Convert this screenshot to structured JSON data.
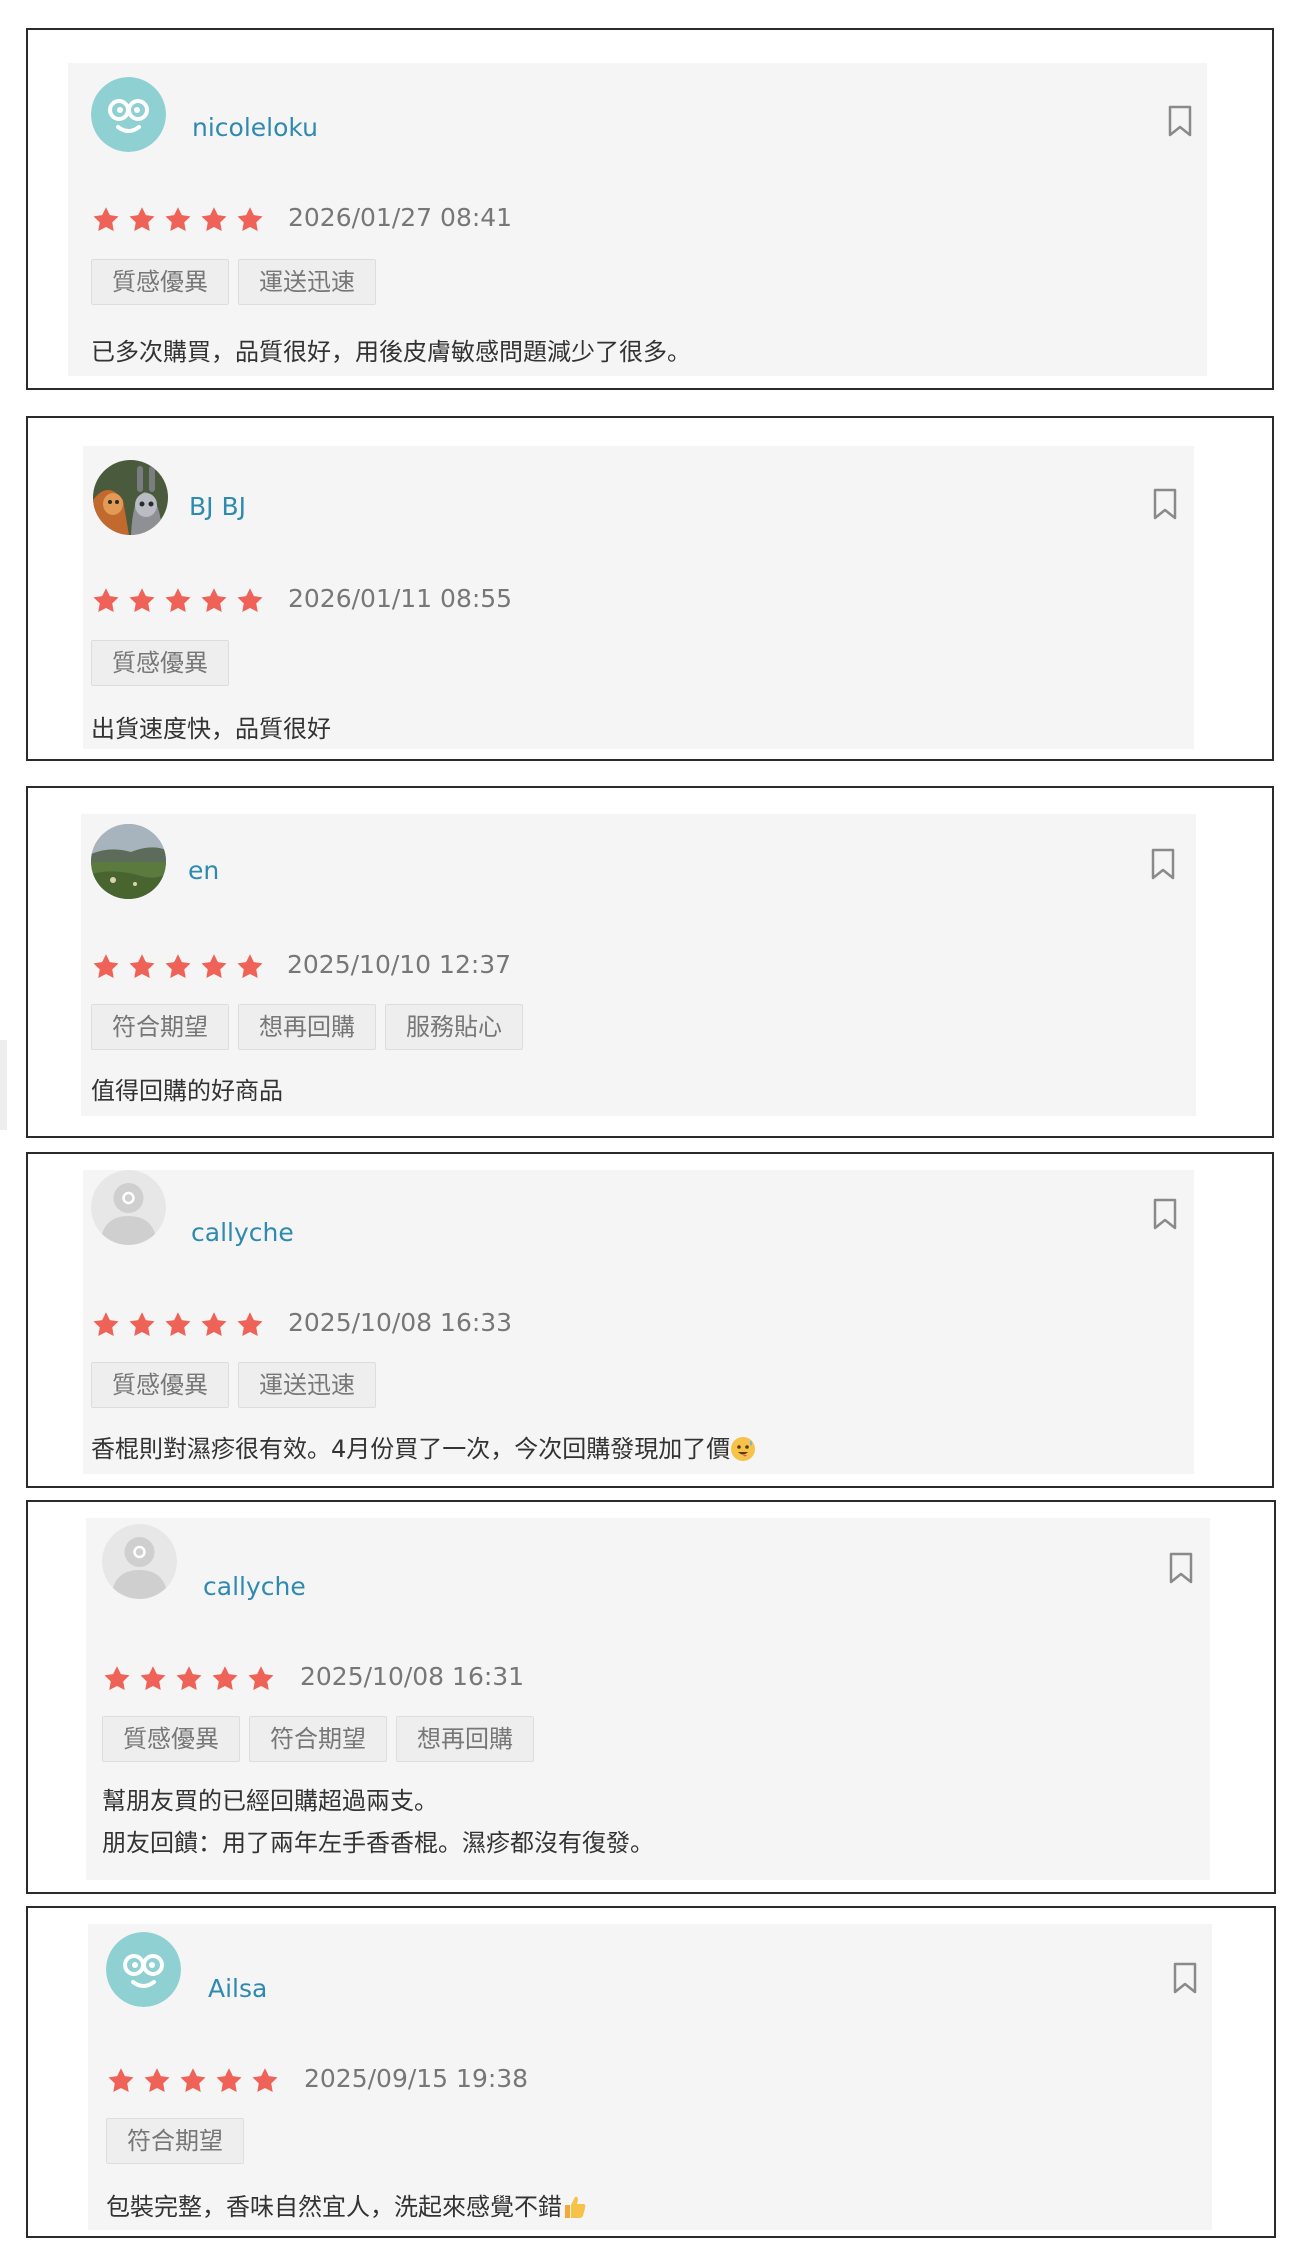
{
  "colors": {
    "accent_username": "#2f8ab0",
    "star": "#ef6257",
    "card_background": "#f5f5f5",
    "frame_border": "#2b2b2b"
  },
  "reviews": [
    {
      "username": "nicoleloku",
      "avatar_icon": "mascot-avatar-icon",
      "rating": 5,
      "date": "2026/01/27 08:41",
      "tags": [
        "質感優異",
        "運送迅速"
      ],
      "comment": "已多次購買，品質很好，用後皮膚敏感問題減少了很多。"
    },
    {
      "username": "BJ BJ",
      "avatar_icon": "cartoon-photo-avatar",
      "rating": 5,
      "date": "2026/01/11 08:55",
      "tags": [
        "質感優異"
      ],
      "comment": "出貨速度快，品質很好"
    },
    {
      "username": "en",
      "avatar_icon": "landscape-photo-avatar",
      "rating": 5,
      "date": "2025/10/10 12:37",
      "tags": [
        "符合期望",
        "想再回購",
        "服務貼心"
      ],
      "comment": "值得回購的好商品"
    },
    {
      "username": "callyche",
      "avatar_icon": "default-user-avatar",
      "rating": 5,
      "date": "2025/10/08 16:33",
      "tags": [
        "質感優異",
        "運送迅速"
      ],
      "comment": "香棍則對濕疹很有效。4月份買了一次，今次回購發現加了價",
      "comment_emoji": "sweat-smile-emoji"
    },
    {
      "username": "callyche",
      "avatar_icon": "default-user-avatar",
      "rating": 5,
      "date": "2025/10/08 16:31",
      "tags": [
        "質感優異",
        "符合期望",
        "想再回購"
      ],
      "comment": "幫朋友買的已經回購超過兩支。\n朋友回饋：用了兩年左手香香棍。濕疹都沒有復發。"
    },
    {
      "username": "Ailsa",
      "avatar_icon": "mascot-avatar-icon",
      "rating": 5,
      "date": "2025/09/15 19:38",
      "tags": [
        "符合期望"
      ],
      "comment": "包裝完整，香味自然宜人，洗起來感覺不錯",
      "comment_emoji": "thumbs-up-emoji"
    }
  ]
}
